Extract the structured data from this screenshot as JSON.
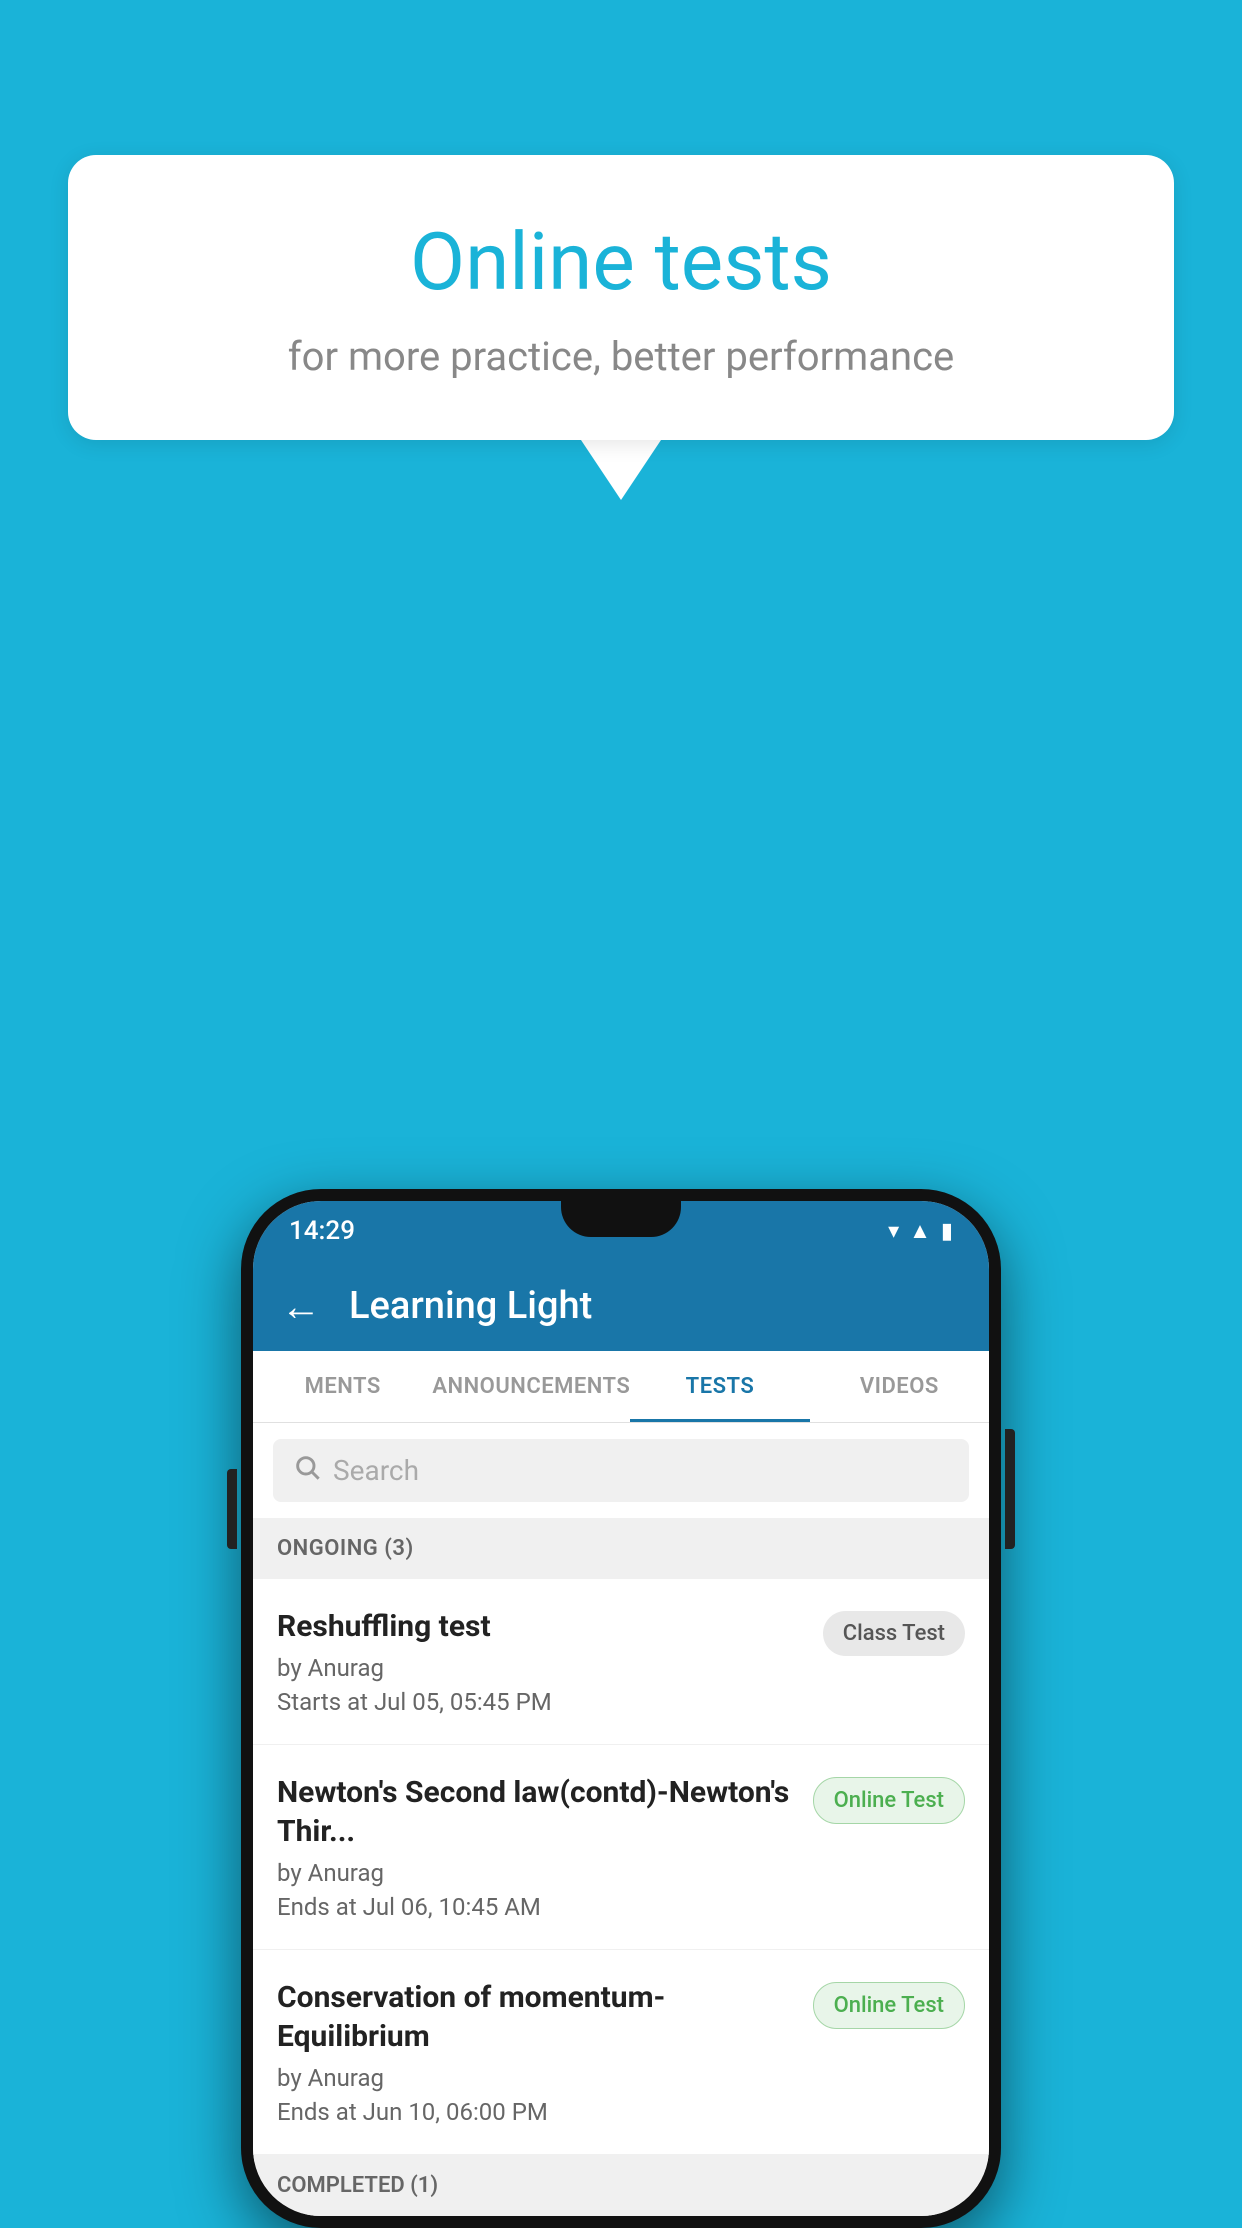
{
  "background_color": "#1ab3d8",
  "speech_bubble": {
    "title": "Online tests",
    "subtitle": "for more practice, better performance"
  },
  "phone": {
    "status_bar": {
      "time": "14:29",
      "icons": [
        "wifi",
        "signal",
        "battery"
      ]
    },
    "app_header": {
      "back_label": "←",
      "title": "Learning Light"
    },
    "tabs": [
      {
        "label": "MENTS",
        "active": false
      },
      {
        "label": "ANNOUNCEMENTS",
        "active": false
      },
      {
        "label": "TESTS",
        "active": true
      },
      {
        "label": "VIDEOS",
        "active": false
      }
    ],
    "search": {
      "placeholder": "Search"
    },
    "sections": [
      {
        "header": "ONGOING (3)",
        "items": [
          {
            "title": "Reshuffling test",
            "author": "by Anurag",
            "time_label": "Starts at",
            "time": "Jul 05, 05:45 PM",
            "badge": "Class Test",
            "badge_type": "class"
          },
          {
            "title": "Newton's Second law(contd)-Newton's Thir...",
            "author": "by Anurag",
            "time_label": "Ends at",
            "time": "Jul 06, 10:45 AM",
            "badge": "Online Test",
            "badge_type": "online"
          },
          {
            "title": "Conservation of momentum-Equilibrium",
            "author": "by Anurag",
            "time_label": "Ends at",
            "time": "Jun 10, 06:00 PM",
            "badge": "Online Test",
            "badge_type": "online"
          }
        ]
      },
      {
        "header": "COMPLETED (1)",
        "items": []
      }
    ]
  }
}
